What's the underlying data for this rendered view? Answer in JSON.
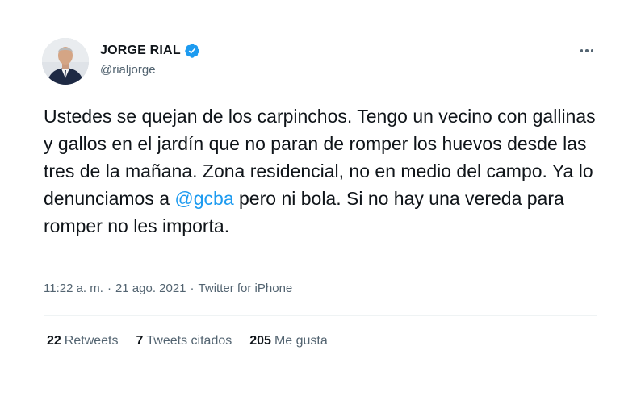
{
  "author": {
    "name": "JORGE RIAL",
    "handle": "@rialjorge"
  },
  "tweet": {
    "text_before": "Ustedes se quejan de los carpinchos. Tengo un vecino con gallinas y gallos en el jardín que no paran de romper los huevos desde las tres de la mañana. Zona residencial, no en medio del campo. Ya lo denunciamos a ",
    "mention": "@gcba",
    "text_after": " pero ni bola. Si no hay una vereda para romper no les importa."
  },
  "meta": {
    "time": "11:22 a. m.",
    "sep1": "·",
    "date": "21 ago. 2021",
    "sep2": "·",
    "source": "Twitter for iPhone"
  },
  "stats": {
    "retweets": {
      "count": "22",
      "label": "Retweets"
    },
    "quotes": {
      "count": "7",
      "label": "Tweets citados"
    },
    "likes": {
      "count": "205",
      "label": "Me gusta"
    }
  },
  "colors": {
    "accent": "#1d9bf0",
    "text": "#0f1419",
    "muted": "#536471",
    "divider": "#eff3f4"
  },
  "icons": {
    "verified": "verified-badge-icon",
    "more": "more-horizontal-icon"
  }
}
